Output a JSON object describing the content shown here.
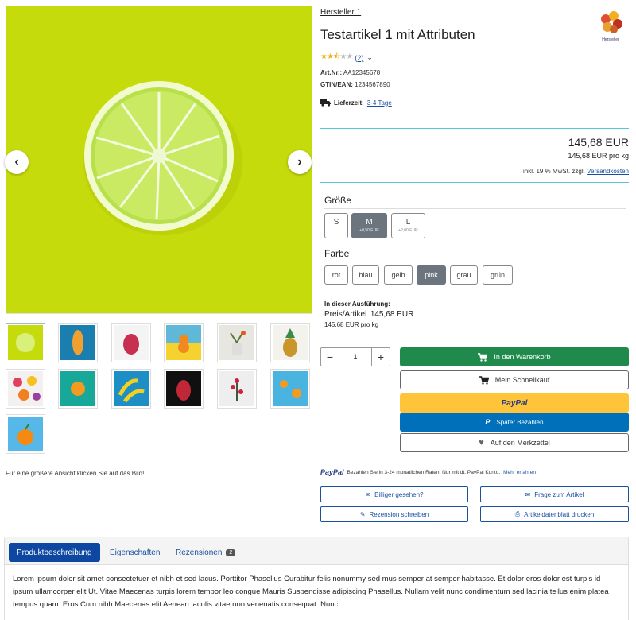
{
  "gallery": {
    "hint": "Für eine größere Ansicht klicken Sie auf das Bild!",
    "thumb_count": 13
  },
  "product": {
    "manufacturer": "Hersteller 1",
    "brand_logo_text": "Hersteller",
    "title": "Testartikel 1 mit Attributen",
    "rating_stars": 2.5,
    "rating_count": "(2)",
    "sku_label": "Art.Nr.:",
    "sku": "AA12345678",
    "gtin_label": "GTIN/EAN:",
    "gtin": "1234567890",
    "delivery_label": "Lieferzeit:",
    "delivery": "3-4 Tage"
  },
  "price": {
    "main": "145,68 EUR",
    "unit": "145,68 EUR pro kg",
    "tax_text": "inkl. 19 % MwSt. zzgl.",
    "shipping_link": "Versandkosten"
  },
  "variations": {
    "size_label": "Größe",
    "sizes": [
      {
        "name": "S",
        "extra": ""
      },
      {
        "name": "M",
        "extra": "+0,50 EUR"
      },
      {
        "name": "L",
        "extra": "+2,00 EUR"
      }
    ],
    "color_label": "Farbe",
    "colors": [
      "rot",
      "blau",
      "gelb",
      "pink",
      "grau",
      "grün"
    ],
    "selected_size": "M",
    "selected_color": "pink"
  },
  "execution": {
    "heading": "In dieser Ausführung:",
    "price_label": "Preis/Artikel",
    "price": "145,68 EUR",
    "unit": "145,68 EUR pro kg"
  },
  "basket": {
    "quantity": "1",
    "minus": "−",
    "plus": "+",
    "add_to_cart": "In den Warenkorb",
    "quick_buy": "Mein Schnellkauf",
    "paypal": "PayPal",
    "pay_later": "Später Bezahlen",
    "wishlist": "Auf den Merkzettel"
  },
  "paypal_info": {
    "logo": "PayPal",
    "text": "Bezahlen Sie in 3-24 monatlichen Raten. Nur mit dt. PayPal Konto.",
    "link": "Mehr erfahren"
  },
  "actions": {
    "cheaper": "Billiger gesehen?",
    "question": "Frage zum Artikel",
    "review": "Rezension schreiben",
    "print": "Artikeldatenblatt drucken"
  },
  "tabs": {
    "description": "Produktbeschreibung",
    "properties": "Eigenschaften",
    "reviews": "Rezensionen",
    "reviews_count": "2",
    "content": "Lorem ipsum dolor sit amet consectetuer et nibh et sed lacus. Porttitor Phasellus Curabitur felis nonummy sed mus semper at semper habitasse. Et dolor eros dolor est turpis id ipsum ullamcorper elit Ut. Vitae Maecenas turpis lorem tempor leo congue Mauris Suspendisse adipiscing Phasellus. Nullam velit nunc condimentum sed lacinia tellus enim platea tempus quam. Eros Cum nibh Maecenas elit Aenean iaculis vitae non venenatis consequat. Nunc."
  },
  "colors": {
    "accent": "#0d47a1",
    "cart_green": "#1f8a4c",
    "paypal_yellow": "#ffc439",
    "paypal_blue": "#0070ba",
    "teal_rule": "#56c7d3",
    "lime_bg": "#c7dc0a"
  }
}
